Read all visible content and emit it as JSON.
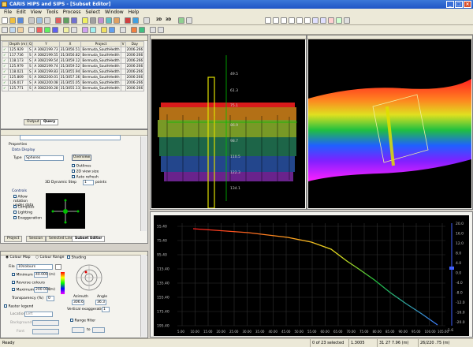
{
  "app": {
    "title": "CARIS HIPS and SIPS - [Subset Editor]"
  },
  "menu": [
    "File",
    "Edit",
    "View",
    "Tools",
    "Process",
    "Select",
    "Window",
    "Help"
  ],
  "toolbar": {
    "view_2d": "2D",
    "view_3d": "3D"
  },
  "query": {
    "headers": [
      "",
      "Depth (m)",
      "Q",
      "Y",
      "X",
      "Project",
      "V",
      "Day"
    ],
    "rows": [
      [
        "✓",
        "125.929",
        "S",
        "A 3082199.73",
        "31/3056.51",
        "Bermuda_SouthHedth",
        "",
        "2006-266"
      ],
      [
        "✓",
        "117.736",
        "S",
        "A 3082199.55",
        "31/3056.82",
        "Bermuda_SouthHedth",
        "",
        "2006-266"
      ],
      [
        "✓",
        "118.173",
        "S",
        "A 3082199.54",
        "31/3059.12",
        "Bermuda_SouthHedth",
        "",
        "2006-266"
      ],
      [
        "✓",
        "125.979",
        "S",
        "A 3082199.74",
        "31/3059.52",
        "Bermuda_SouthHedth",
        "",
        "2006-266"
      ],
      [
        "✓",
        "118.021",
        "S",
        "A 3082199.83",
        "31/3055.94",
        "Bermuda_SouthHedth",
        "",
        "2006-266"
      ],
      [
        "✓",
        "125.809",
        "S",
        "A 3082200.01",
        "31/3057.36",
        "Bermuda_SouthHedth",
        "",
        "2006-266"
      ],
      [
        "✓",
        "126.017",
        "S",
        "A 3082200.08",
        "31/3055.05",
        "Bermuda_SouthHedth",
        "",
        "2006-266"
      ],
      [
        "✓",
        "125.771",
        "S",
        "A 3082200.28",
        "31/3055.13",
        "Bermuda_SouthHedth",
        "",
        "2006-266"
      ]
    ],
    "tabs": [
      "Output",
      "Query"
    ]
  },
  "properties": {
    "title": "Properties",
    "data_display": "Data Display",
    "type_label": "Type",
    "type_value": "Spheres",
    "overview_btn": "Overview",
    "outlines": "Outlines",
    "view_size": "2D view size",
    "auto_refresh": "Auto refresh",
    "step_label": "3D Dynamic Step",
    "step_value": "1",
    "points": "points",
    "controls": "Controls",
    "allow_rotation": "Allow rotation under data",
    "compass": "Compass",
    "lighting": "Lighting",
    "exaggeration": "Exaggeration",
    "tabs": [
      "Project",
      "Session",
      "Selected Lines",
      "Subset Editor"
    ]
  },
  "colour": {
    "colour_map": "Colour Map",
    "colour_range": "Colour Range",
    "file_label": "File",
    "file_value": "10colours",
    "minimum": "Minimum",
    "min_value": "40.000",
    "unit": "(m)",
    "reverse": "Reverse colours",
    "maximum": "Maximum",
    "max_value": "200.000",
    "transparency": "Transparency (%)",
    "transparency_value": "0",
    "shading": "Shading",
    "azimuth_label": "Azimuth",
    "azimuth_value": "306.6",
    "angle_label": "Angle",
    "angle_value": "36.3",
    "vert_exag": "Vertical exaggeration",
    "vert_value": "1",
    "raster_legend": "Raster legend",
    "location_label": "Location",
    "location_value": "Left",
    "background": "Background",
    "font": "Font",
    "range_filter": "Range filter",
    "to": "to"
  },
  "plan3d": {
    "labels": [
      "49.5",
      "61.3",
      "75.1",
      "86.9",
      "98.7",
      "110.5",
      "122.3",
      "134.1"
    ]
  },
  "profile": {
    "y_ticks": [
      "55.40",
      "75.40",
      "95.40",
      "115.40",
      "135.40",
      "155.40",
      "175.40",
      "195.40"
    ],
    "x_ticks": [
      "5.00",
      "10.00",
      "15.00",
      "20.00",
      "25.00",
      "30.00",
      "35.00",
      "40.00",
      "45.00",
      "50.00",
      "55.00",
      "60.00",
      "65.00",
      "70.00",
      "75.00",
      "80.00",
      "85.00",
      "90.00",
      "95.00",
      "100.00",
      "105.00"
    ],
    "scale_ticks": [
      "20.0",
      "16.0",
      "12.0",
      "8.0",
      "4.0",
      "0.0",
      "-4.0",
      "-8.0",
      "-12.0",
      "-16.0",
      "-20.0"
    ],
    "scale_bottom": "1.6"
  },
  "status": {
    "ready": "Ready",
    "selected": "0 of 23 selected",
    "zoom": "1.3005",
    "position": "31 27 7.96 (m)",
    "coords": "26/220 .75 (m)"
  },
  "colors": {
    "title_blue": "#245edb",
    "accent_yellow": "#e0e000"
  }
}
